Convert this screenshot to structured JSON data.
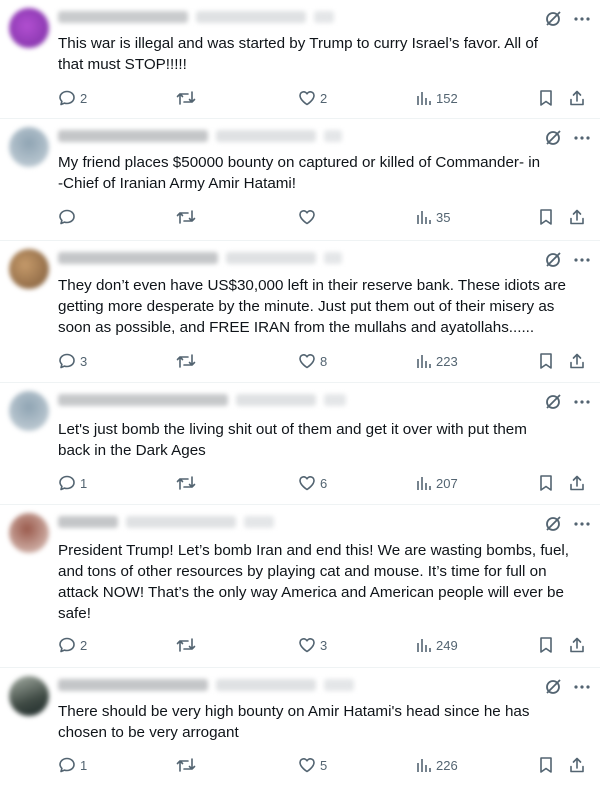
{
  "colors": {
    "text": "#0f1419",
    "muted": "#536471",
    "divider": "#eff3f4"
  },
  "posts": [
    {
      "text": "This war is illegal and was started by Trump to curry Israel’s favor.  All of\nthat must STOP!!!!!",
      "replies": "2",
      "reposts": "",
      "likes": "2",
      "views": "152"
    },
    {
      "text": "My friend places $50000 bounty on captured or killed of   Commander- in\n-Chief of Iranian Army Amir Hatami!",
      "replies": "",
      "reposts": "",
      "likes": "",
      "views": "35"
    },
    {
      "text": "They don’t even have US$30,000 left in their reserve bank. These idiots are\ngetting more desperate by the minute. Just put them out of their misery as\nsoon as possible, and FREE IRAN from the mullahs and ayatollahs......",
      "replies": "3",
      "reposts": "",
      "likes": "8",
      "views": "223"
    },
    {
      "text": "Let's just bomb the living shit out of them and get it over with put them\nback in the Dark Ages",
      "replies": "1",
      "reposts": "",
      "likes": "6",
      "views": "207"
    },
    {
      "text": "President Trump! Let’s bomb Iran and end this! We are wasting bombs, fuel,\nand tons of other resources by playing cat and mouse. It’s time for full on\nattack NOW! That’s the only way America and American people will ever be\nsafe!",
      "replies": "2",
      "reposts": "",
      "likes": "3",
      "views": "249"
    },
    {
      "text": "There should be very high bounty on Amir Hatami's head since he has\nchosen to be very arrogant",
      "replies": "1",
      "reposts": "",
      "likes": "5",
      "views": "226"
    }
  ],
  "icons": {
    "grok": "grok-icon",
    "more": "more-icon",
    "reply": "reply-icon",
    "repost": "repost-icon",
    "like": "heart-icon",
    "views": "views-icon",
    "bookmark": "bookmark-icon",
    "share": "share-icon"
  }
}
